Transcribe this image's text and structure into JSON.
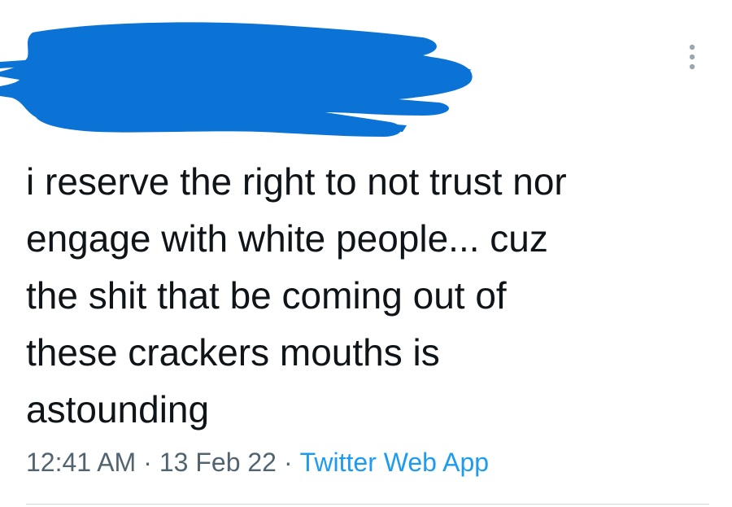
{
  "tweet": {
    "text_lines": [
      "i reserve the right to not trust nor",
      "engage with white people... cuz",
      "the shit that be coming out of",
      "these crackers mouths is",
      "astounding"
    ],
    "time": "12:41 AM",
    "date": "13 Feb 22",
    "separator": "·",
    "source": "Twitter Web App"
  },
  "header": {
    "more_icon": "vertical-ellipsis-icon",
    "redaction_color": "#0b72d6"
  },
  "colors": {
    "text": "#0f1419",
    "meta": "#536471",
    "link": "#1d9bf0",
    "divider": "#cfd9de"
  }
}
